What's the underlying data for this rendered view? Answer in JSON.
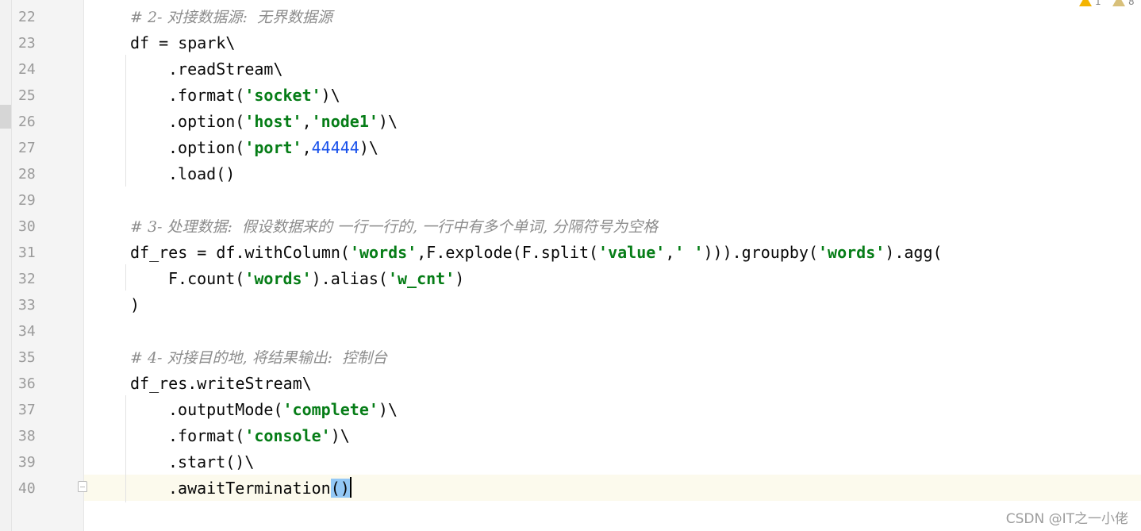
{
  "editor": {
    "line_numbers": [
      "22",
      "23",
      "24",
      "25",
      "26",
      "27",
      "28",
      "29",
      "30",
      "31",
      "32",
      "33",
      "34",
      "35",
      "36",
      "37",
      "38",
      "39",
      "40"
    ],
    "lines": {
      "l22": {
        "comment": "# 2- 对接数据源:  无界数据源"
      },
      "l23": {
        "code": "df = spark\\"
      },
      "l24": {
        "code": ".readStream\\"
      },
      "l25": {
        "a": ".format(",
        "s1": "'socket'",
        "b": ")\\"
      },
      "l26": {
        "a": ".option(",
        "s1": "'host'",
        "b": ",",
        "s2": "'node1'",
        "c": ")\\"
      },
      "l27": {
        "a": ".option(",
        "s1": "'port'",
        "b": ",",
        "n1": "44444",
        "c": ")\\"
      },
      "l28": {
        "code": ".load()"
      },
      "l30": {
        "comment": "# 3- 处理数据:  假设数据来的 一行一行的, 一行中有多个单词, 分隔符号为空格"
      },
      "l31": {
        "a": "df_res = df.withColumn(",
        "s1": "'words'",
        "b": ",F.explode(F.split(",
        "s2": "'value'",
        "c": ",",
        "s3": "' '",
        "d": "))).groupby(",
        "s4": "'words'",
        "e": ").agg("
      },
      "l32": {
        "a": "F.count(",
        "s1": "'words'",
        "b": ").alias(",
        "s2": "'w_cnt'",
        "c": ")"
      },
      "l33": {
        "code": ")"
      },
      "l35": {
        "comment": "# 4- 对接目的地, 将结果输出:  控制台"
      },
      "l36": {
        "code": "df_res.writeStream\\"
      },
      "l37": {
        "a": ".outputMode(",
        "s1": "'complete'",
        "b": ")\\"
      },
      "l38": {
        "a": ".format(",
        "s1": "'console'",
        "b": ")\\"
      },
      "l39": {
        "code": ".start()\\"
      },
      "l40": {
        "a": ".awaitTermination",
        "p": "()"
      }
    }
  },
  "inspections": {
    "warnings": "1",
    "weak_warnings": "8"
  },
  "watermark": "CSDN @IT之一小佬",
  "colors": {
    "comment": "#8c8c8c",
    "string": "#067d17",
    "number": "#1750eb",
    "text": "#080808",
    "line_number": "#9a9a9a",
    "current_line": "#fcfaed",
    "brace_match": "#93c8f5"
  }
}
